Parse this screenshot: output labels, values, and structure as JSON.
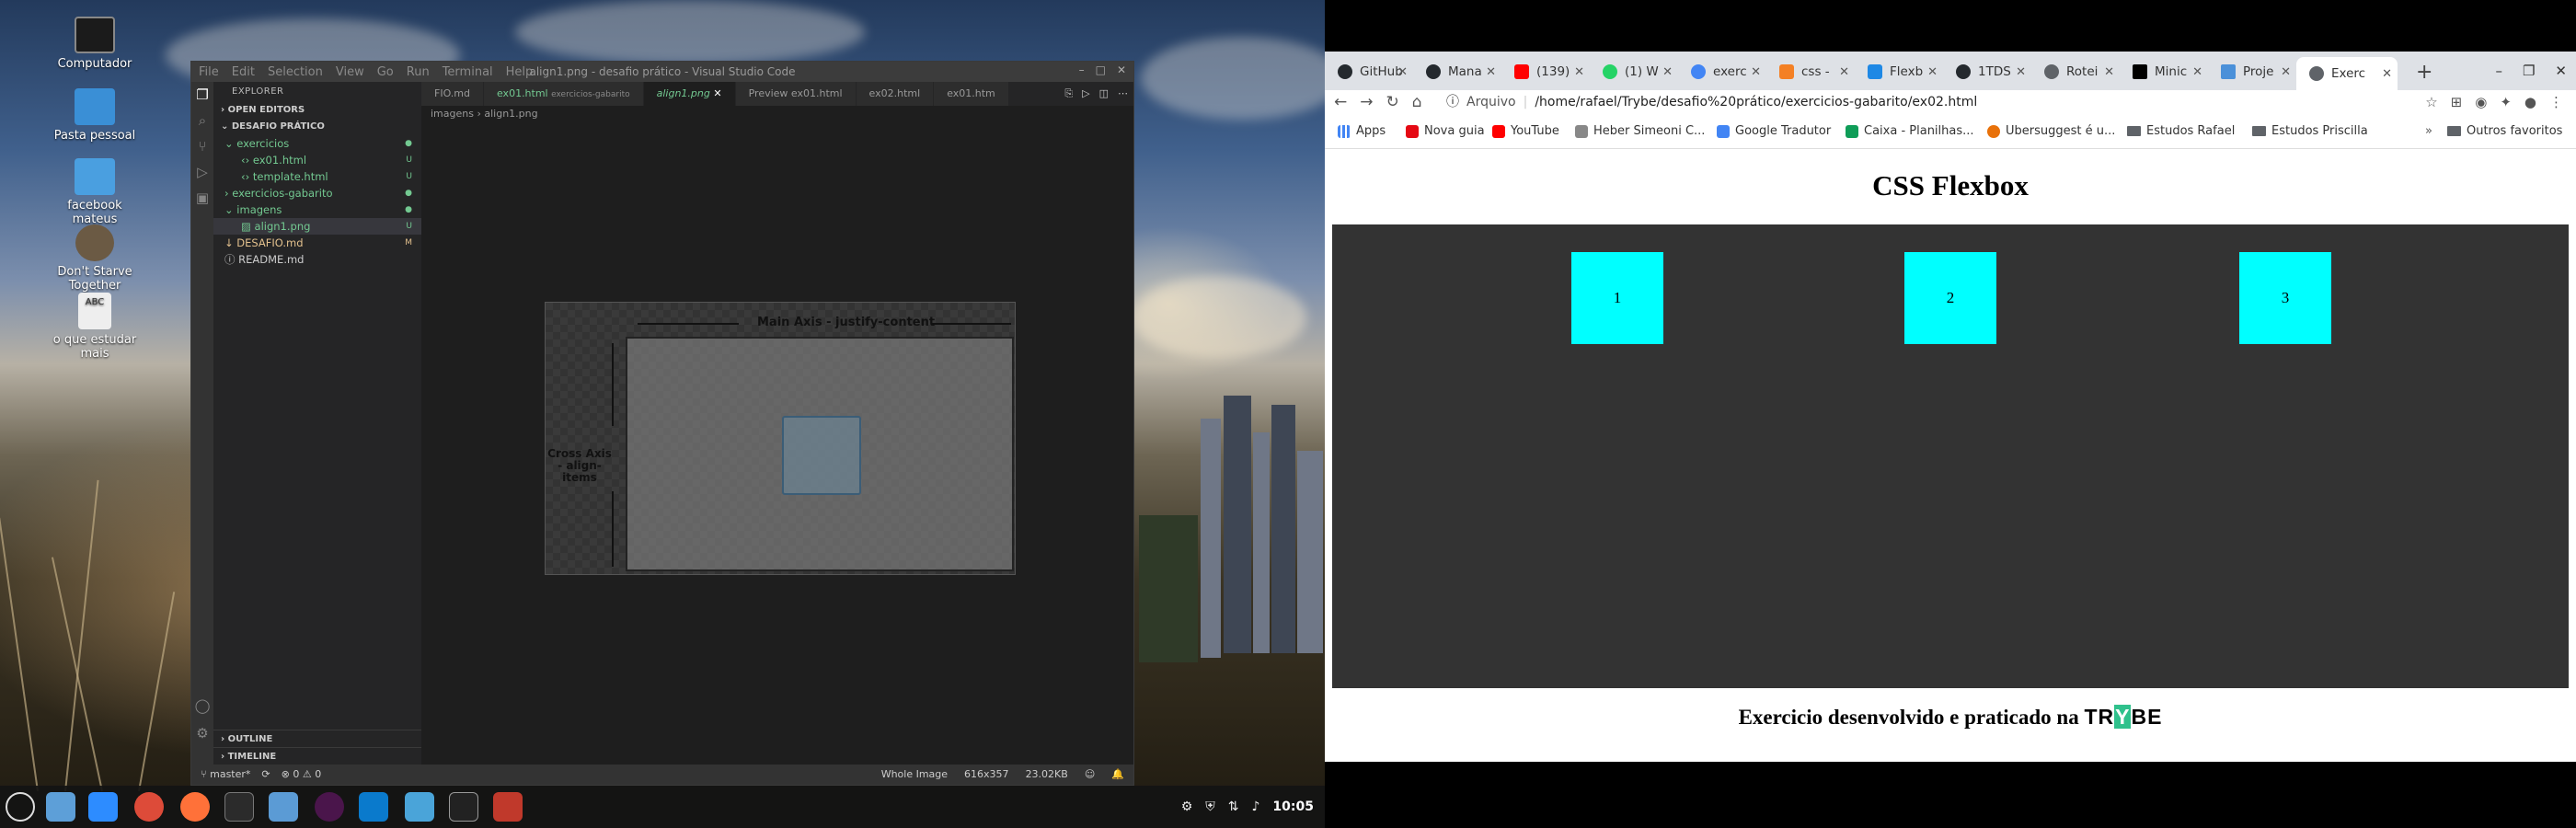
{
  "desktop": {
    "icons": [
      {
        "label": "Computador"
      },
      {
        "label": "Pasta pessoal"
      },
      {
        "label": "facebook mateus"
      },
      {
        "label": "Don't Starve Together"
      },
      {
        "label": "o que estudar mais"
      }
    ]
  },
  "vscode": {
    "title": "align1.png - desafio prático - Visual Studio Code",
    "menu": [
      "File",
      "Edit",
      "Selection",
      "View",
      "Go",
      "Run",
      "Terminal",
      "Help"
    ],
    "sidebar": {
      "header": "EXPLORER",
      "open_editors": "OPEN EDITORS",
      "workspace": "DESAFIO PRÁTICO",
      "tree": [
        {
          "label": "exercicios",
          "badge": "●"
        },
        {
          "label": "ex01.html",
          "badge": "U"
        },
        {
          "label": "template.html",
          "badge": "U"
        },
        {
          "label": "exercicios-gabarito",
          "badge": "●"
        },
        {
          "label": "imagens",
          "badge": "●"
        },
        {
          "label": "align1.png",
          "badge": "U"
        },
        {
          "label": "DESAFIO.md",
          "badge": "M"
        },
        {
          "label": "README.md",
          "badge": ""
        }
      ],
      "outline": "OUTLINE",
      "timeline": "TIMELINE"
    },
    "tabs": [
      {
        "label": "FIO.md"
      },
      {
        "label": "ex01.html",
        "hint": "exercicios-gabarito"
      },
      {
        "label": "align1.png"
      },
      {
        "label": "Preview ex01.html"
      },
      {
        "label": "ex02.html"
      },
      {
        "label": "ex01.htm"
      }
    ],
    "breadcrumb": [
      "imagens",
      "align1.png"
    ],
    "image": {
      "main_axis_label": "Main Axis - justify-content",
      "cross_axis_label": "Cross Axis - align-items"
    },
    "status": {
      "branch": "master*",
      "problems": "⊗ 0 ⚠ 0",
      "zoom": "Whole Image",
      "dimensions": "616x357",
      "size": "23.02KB"
    }
  },
  "taskbar": {
    "clock": "10:05"
  },
  "browser": {
    "tabs": [
      {
        "label": "GitHub",
        "color": "#24292e"
      },
      {
        "label": "Mana",
        "color": "#24292e"
      },
      {
        "label": "(139)",
        "color": "#ff0000"
      },
      {
        "label": "(1) W",
        "color": "#25d366"
      },
      {
        "label": "exerc",
        "color": "#4285f4"
      },
      {
        "label": "css -",
        "color": "#f48024"
      },
      {
        "label": "Flexb",
        "color": "#1e88e5"
      },
      {
        "label": "1TDS",
        "color": "#24292e"
      },
      {
        "label": "Rotei",
        "color": "#5f6368"
      },
      {
        "label": "Minic",
        "color": "#000000"
      },
      {
        "label": "Proje",
        "color": "#4a90d9"
      },
      {
        "label": "Exerc",
        "color": "#5f6368"
      }
    ],
    "address": {
      "scheme_label": "Arquivo",
      "url": "/home/rafael/Trybe/desafio%20prático/exercicios-gabarito/ex02.html"
    },
    "bookmarks": [
      {
        "label": "Apps"
      },
      {
        "label": "Nova guia"
      },
      {
        "label": "YouTube"
      },
      {
        "label": "Heber Simeoni C..."
      },
      {
        "label": "Google Tradutor"
      },
      {
        "label": "Caixa - Planilhas..."
      },
      {
        "label": "Ubersuggest é u..."
      },
      {
        "label": "Estudos Rafael"
      },
      {
        "label": "Estudos Priscilla"
      },
      {
        "label": "Outros favoritos"
      }
    ],
    "page": {
      "title": "CSS Flexbox",
      "items": [
        "1",
        "2",
        "3"
      ],
      "footer_text": "Exercicio desenvolvido e praticado na",
      "brand": "TRYBE"
    }
  }
}
